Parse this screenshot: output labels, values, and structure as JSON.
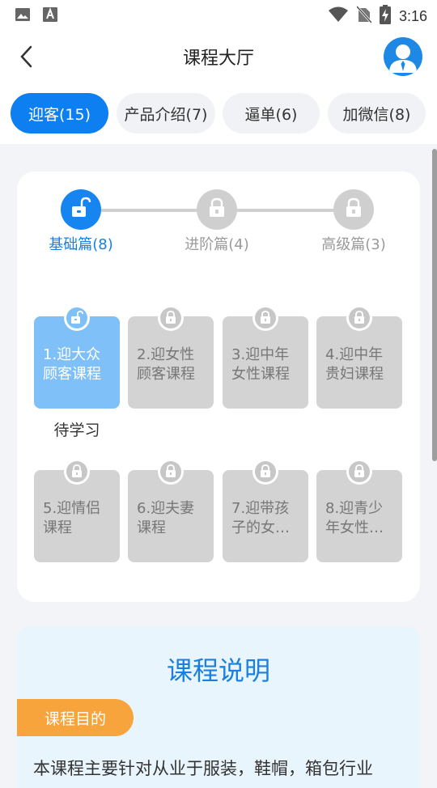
{
  "status_bar": {
    "time": "3:16"
  },
  "nav": {
    "title": "课程大厅"
  },
  "tabs": [
    {
      "label": "迎客(15)",
      "active": true
    },
    {
      "label": "产品介绍(7)",
      "active": false
    },
    {
      "label": "逼单(6)",
      "active": false
    },
    {
      "label": "加微信(8)",
      "active": false
    }
  ],
  "levels": [
    {
      "label": "基础篇(8)",
      "locked": false
    },
    {
      "label": "进阶篇(4)",
      "locked": true
    },
    {
      "label": "高级篇(3)",
      "locked": true
    }
  ],
  "courses": [
    {
      "text": "1.迎大众顾客课程",
      "locked": false,
      "status": "待学习"
    },
    {
      "text": "2.迎女性顾客课程",
      "locked": true
    },
    {
      "text": "3.迎中年女性课程",
      "locked": true
    },
    {
      "text": "4.迎中年贵妇课程",
      "locked": true
    },
    {
      "text": "5.迎情侣课程",
      "locked": true
    },
    {
      "text": "6.迎夫妻课程",
      "locked": true
    },
    {
      "text": "7.迎带孩子的女…",
      "locked": true
    },
    {
      "text": "8.迎青少年女性…",
      "locked": true
    }
  ],
  "description": {
    "title": "课程说明",
    "purpose_label": "课程目的",
    "body": "本课程主要针对从业于服装，鞋帽，箱包行业"
  },
  "colors": {
    "accent": "#0d7ff0",
    "active_course": "#7fc0f8",
    "tag": "#f8a43c"
  },
  "icons": {
    "back": "chevron-left-icon",
    "avatar": "user-avatar-icon",
    "unlocked": "unlock-icon",
    "locked": "lock-icon"
  }
}
